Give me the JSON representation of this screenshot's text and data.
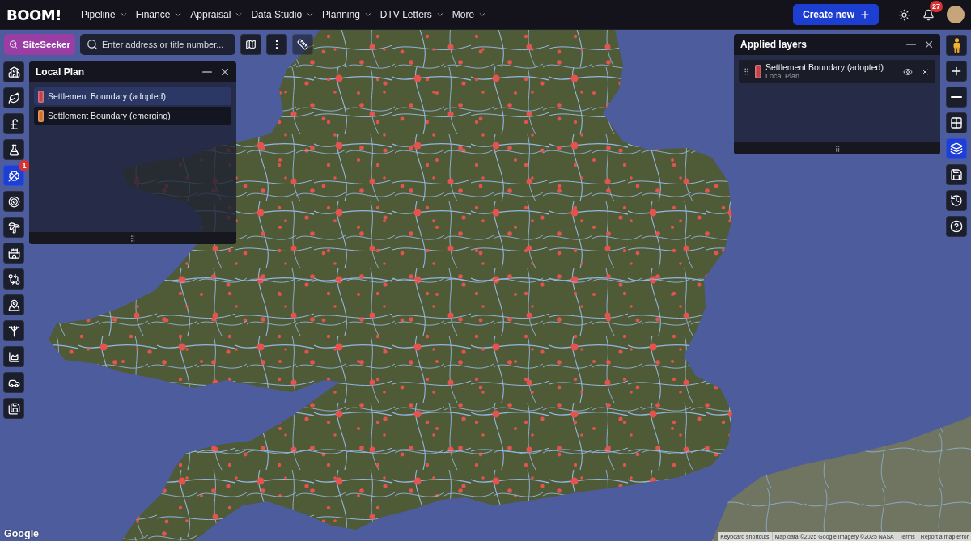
{
  "top_bar": {
    "logo": "BOOM!",
    "nav": [
      {
        "label": "Pipeline"
      },
      {
        "label": "Finance"
      },
      {
        "label": "Appraisal"
      },
      {
        "label": "Data Studio"
      },
      {
        "label": "Planning"
      },
      {
        "label": "DTV Letters"
      },
      {
        "label": "More"
      }
    ],
    "create_button": "Create new",
    "notifications_badge": "27"
  },
  "map_toolbar": {
    "siteseeker_button": "SiteSeeker",
    "search": {
      "placeholder": "Enter address or title number..."
    }
  },
  "left_tools": [
    {
      "selected": false
    },
    {
      "selected": false
    },
    {
      "selected": false
    },
    {
      "selected": false
    },
    {
      "selected": true,
      "badge": "1"
    },
    {
      "selected": false
    },
    {
      "selected": false
    },
    {
      "selected": false
    },
    {
      "selected": false
    },
    {
      "selected": false
    },
    {
      "selected": false
    },
    {
      "selected": false
    },
    {
      "selected": false
    },
    {
      "selected": false
    }
  ],
  "local_plan_panel": {
    "title": "Local Plan",
    "items": [
      {
        "label": "Settlement Boundary (adopted)",
        "color": "#c2414b",
        "selected": true
      },
      {
        "label": "Settlement Boundary (emerging)",
        "color": "#d2702a",
        "selected": false
      }
    ]
  },
  "applied_layers_panel": {
    "title": "Applied layers",
    "layers": [
      {
        "name": "Settlement Boundary (adopted)",
        "source": "Local Plan",
        "color": "#c2414b"
      }
    ]
  },
  "right_tools": [
    {
      "selected": false
    },
    {
      "selected": false
    },
    {
      "selected": false
    },
    {
      "selected": false
    },
    {
      "selected": true
    },
    {
      "selected": false
    },
    {
      "selected": false
    },
    {
      "selected": false
    }
  ],
  "map_footer": {
    "logo": "Google",
    "links": [
      "Keyboard shortcuts",
      "Map data ©2025 Google Imagery ©2025 NASA",
      "Terms",
      "Report a map error"
    ]
  }
}
